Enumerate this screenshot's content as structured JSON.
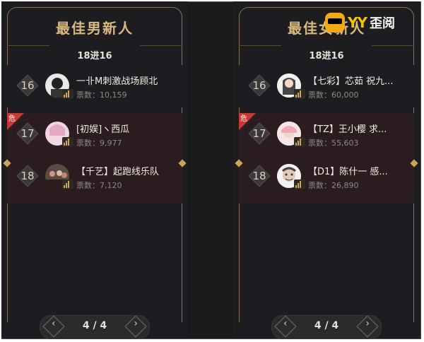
{
  "panels": [
    {
      "title": "最佳男新人",
      "round": "18进16",
      "rows": [
        {
          "rank": "16",
          "name": "一卝M刺激战场顾北",
          "votes": "票数：10,159",
          "danger": false
        },
        {
          "rank": "17",
          "name": "[初娱]ヽ西瓜",
          "votes": "票数：9,977",
          "danger": true
        },
        {
          "rank": "18",
          "name": "【千艺】起跑线乐队",
          "votes": "票数：7,120",
          "danger": true
        }
      ],
      "pager": "4 / 4"
    },
    {
      "title": "最佳女新人",
      "round": "18进16",
      "rows": [
        {
          "rank": "16",
          "name": "【七彩】芯茹 祝九...",
          "votes": "票数：60,000",
          "danger": false
        },
        {
          "rank": "17",
          "name": "【TZ】王小樱 求...",
          "votes": "票数：55,603",
          "danger": true
        },
        {
          "rank": "18",
          "name": "【D1】陈什一 感...",
          "votes": "票数：26,890",
          "danger": true
        }
      ],
      "pager": "4 / 4"
    }
  ],
  "danger_label": "危",
  "watermark": {
    "brand": "YY",
    "sub": "歪阅"
  }
}
